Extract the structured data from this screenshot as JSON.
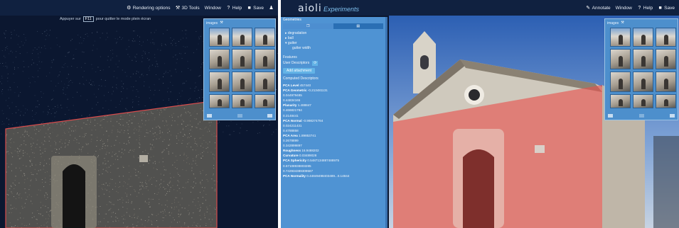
{
  "left_view": {
    "toolbar": [
      {
        "icon": "gears-icon",
        "label": "Rendering options"
      },
      {
        "icon": "tools-icon",
        "label": "3D Tools"
      },
      {
        "icon": "",
        "label": "Window"
      },
      {
        "icon": "help-icon",
        "label": "Help"
      },
      {
        "icon": "save-icon",
        "label": "Save"
      },
      {
        "icon": "bell-icon",
        "label": ""
      }
    ],
    "fullscreen_hint": {
      "before": "Appuyer sur",
      "key": "F11",
      "after": "pour quitter le mode plein écran"
    },
    "images_panel": {
      "title": "images"
    }
  },
  "right_view": {
    "brand": {
      "name": "aioli",
      "subtitle": "Experiments"
    },
    "toolbar": [
      {
        "icon": "pencil-icon",
        "label": "Annotate"
      },
      {
        "icon": "",
        "label": "Window"
      },
      {
        "icon": "help-icon",
        "label": "Help"
      },
      {
        "icon": "save-icon",
        "label": "Save"
      }
    ],
    "images_panel": {
      "title": "images"
    },
    "side_panel": {
      "header": "Geometries",
      "tree": [
        "degradation",
        "ball",
        "gutter",
        "gutter width"
      ],
      "section_title": "Features",
      "user_descriptors_label": "User Descriptors",
      "add_button": "Add attachment",
      "computed_label": "Computed Descriptors",
      "descriptors": [
        {
          "name": "PCA Level",
          "value": "457440"
        },
        {
          "name": "PCA Geometric",
          "value": "-0.213481131"
        },
        {
          "name": "",
          "value": "0.044979485"
        },
        {
          "name": "",
          "value": "0.44834165"
        },
        {
          "name": "Planarity",
          "value": "1.488847"
        },
        {
          "name": "",
          "value": "0.466821784"
        },
        {
          "name": "",
          "value": "0.2148441"
        },
        {
          "name": "PCA Normal",
          "value": "-0.998274784"
        },
        {
          "name": "",
          "value": "0.024211431"
        },
        {
          "name": "",
          "value": "0.4788858"
        },
        {
          "name": "PCA Area",
          "value": "1.89853741"
        },
        {
          "name": "",
          "value": "0.2678899"
        },
        {
          "name": "",
          "value": "0.342899897"
        },
        {
          "name": "Roughness",
          "value": "16.9488202"
        },
        {
          "name": "Curvature",
          "value": "0.03489028"
        },
        {
          "name": "PCA Sphericity",
          "value": "0.5487134887488975"
        },
        {
          "name": "",
          "value": "0.67108938803285"
        },
        {
          "name": "",
          "value": "0.742934389309587"
        },
        {
          "name": "PCA Normality",
          "value": "0.44849498403489...0.14844"
        }
      ]
    }
  },
  "colors": {
    "toolbar_bg": "#102140",
    "panel_blue": "#4f93d3",
    "accent_button": "#63b3e6",
    "annotation_red": "#e8504c"
  }
}
